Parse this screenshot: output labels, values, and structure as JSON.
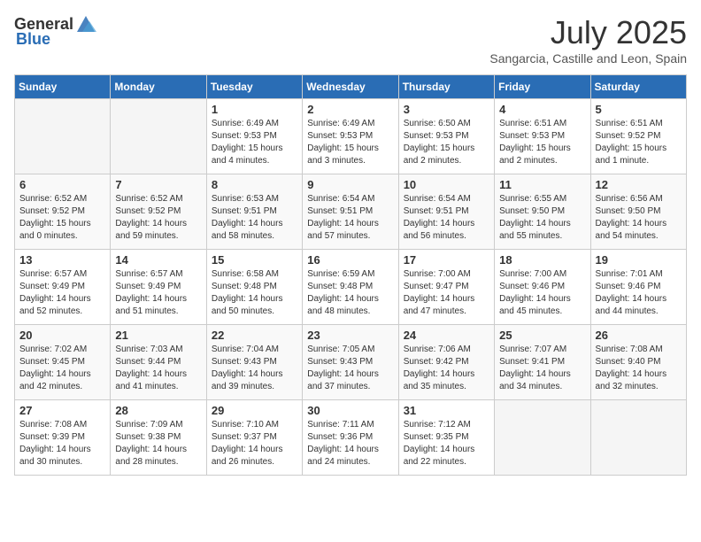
{
  "header": {
    "logo_general": "General",
    "logo_blue": "Blue",
    "month": "July 2025",
    "location": "Sangarcia, Castille and Leon, Spain"
  },
  "weekdays": [
    "Sunday",
    "Monday",
    "Tuesday",
    "Wednesday",
    "Thursday",
    "Friday",
    "Saturday"
  ],
  "weeks": [
    [
      {
        "day": "",
        "text": ""
      },
      {
        "day": "",
        "text": ""
      },
      {
        "day": "1",
        "text": "Sunrise: 6:49 AM\nSunset: 9:53 PM\nDaylight: 15 hours\nand 4 minutes."
      },
      {
        "day": "2",
        "text": "Sunrise: 6:49 AM\nSunset: 9:53 PM\nDaylight: 15 hours\nand 3 minutes."
      },
      {
        "day": "3",
        "text": "Sunrise: 6:50 AM\nSunset: 9:53 PM\nDaylight: 15 hours\nand 2 minutes."
      },
      {
        "day": "4",
        "text": "Sunrise: 6:51 AM\nSunset: 9:53 PM\nDaylight: 15 hours\nand 2 minutes."
      },
      {
        "day": "5",
        "text": "Sunrise: 6:51 AM\nSunset: 9:52 PM\nDaylight: 15 hours\nand 1 minute."
      }
    ],
    [
      {
        "day": "6",
        "text": "Sunrise: 6:52 AM\nSunset: 9:52 PM\nDaylight: 15 hours\nand 0 minutes."
      },
      {
        "day": "7",
        "text": "Sunrise: 6:52 AM\nSunset: 9:52 PM\nDaylight: 14 hours\nand 59 minutes."
      },
      {
        "day": "8",
        "text": "Sunrise: 6:53 AM\nSunset: 9:51 PM\nDaylight: 14 hours\nand 58 minutes."
      },
      {
        "day": "9",
        "text": "Sunrise: 6:54 AM\nSunset: 9:51 PM\nDaylight: 14 hours\nand 57 minutes."
      },
      {
        "day": "10",
        "text": "Sunrise: 6:54 AM\nSunset: 9:51 PM\nDaylight: 14 hours\nand 56 minutes."
      },
      {
        "day": "11",
        "text": "Sunrise: 6:55 AM\nSunset: 9:50 PM\nDaylight: 14 hours\nand 55 minutes."
      },
      {
        "day": "12",
        "text": "Sunrise: 6:56 AM\nSunset: 9:50 PM\nDaylight: 14 hours\nand 54 minutes."
      }
    ],
    [
      {
        "day": "13",
        "text": "Sunrise: 6:57 AM\nSunset: 9:49 PM\nDaylight: 14 hours\nand 52 minutes."
      },
      {
        "day": "14",
        "text": "Sunrise: 6:57 AM\nSunset: 9:49 PM\nDaylight: 14 hours\nand 51 minutes."
      },
      {
        "day": "15",
        "text": "Sunrise: 6:58 AM\nSunset: 9:48 PM\nDaylight: 14 hours\nand 50 minutes."
      },
      {
        "day": "16",
        "text": "Sunrise: 6:59 AM\nSunset: 9:48 PM\nDaylight: 14 hours\nand 48 minutes."
      },
      {
        "day": "17",
        "text": "Sunrise: 7:00 AM\nSunset: 9:47 PM\nDaylight: 14 hours\nand 47 minutes."
      },
      {
        "day": "18",
        "text": "Sunrise: 7:00 AM\nSunset: 9:46 PM\nDaylight: 14 hours\nand 45 minutes."
      },
      {
        "day": "19",
        "text": "Sunrise: 7:01 AM\nSunset: 9:46 PM\nDaylight: 14 hours\nand 44 minutes."
      }
    ],
    [
      {
        "day": "20",
        "text": "Sunrise: 7:02 AM\nSunset: 9:45 PM\nDaylight: 14 hours\nand 42 minutes."
      },
      {
        "day": "21",
        "text": "Sunrise: 7:03 AM\nSunset: 9:44 PM\nDaylight: 14 hours\nand 41 minutes."
      },
      {
        "day": "22",
        "text": "Sunrise: 7:04 AM\nSunset: 9:43 PM\nDaylight: 14 hours\nand 39 minutes."
      },
      {
        "day": "23",
        "text": "Sunrise: 7:05 AM\nSunset: 9:43 PM\nDaylight: 14 hours\nand 37 minutes."
      },
      {
        "day": "24",
        "text": "Sunrise: 7:06 AM\nSunset: 9:42 PM\nDaylight: 14 hours\nand 35 minutes."
      },
      {
        "day": "25",
        "text": "Sunrise: 7:07 AM\nSunset: 9:41 PM\nDaylight: 14 hours\nand 34 minutes."
      },
      {
        "day": "26",
        "text": "Sunrise: 7:08 AM\nSunset: 9:40 PM\nDaylight: 14 hours\nand 32 minutes."
      }
    ],
    [
      {
        "day": "27",
        "text": "Sunrise: 7:08 AM\nSunset: 9:39 PM\nDaylight: 14 hours\nand 30 minutes."
      },
      {
        "day": "28",
        "text": "Sunrise: 7:09 AM\nSunset: 9:38 PM\nDaylight: 14 hours\nand 28 minutes."
      },
      {
        "day": "29",
        "text": "Sunrise: 7:10 AM\nSunset: 9:37 PM\nDaylight: 14 hours\nand 26 minutes."
      },
      {
        "day": "30",
        "text": "Sunrise: 7:11 AM\nSunset: 9:36 PM\nDaylight: 14 hours\nand 24 minutes."
      },
      {
        "day": "31",
        "text": "Sunrise: 7:12 AM\nSunset: 9:35 PM\nDaylight: 14 hours\nand 22 minutes."
      },
      {
        "day": "",
        "text": ""
      },
      {
        "day": "",
        "text": ""
      }
    ]
  ]
}
